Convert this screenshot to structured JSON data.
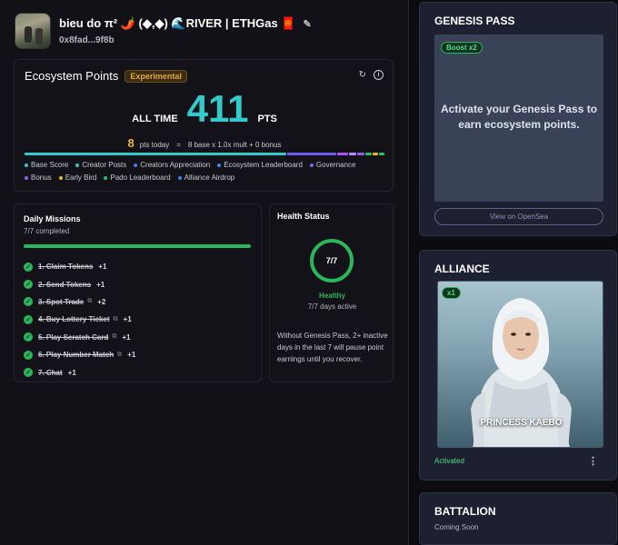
{
  "profile": {
    "name": "bieu do π² 🌶️ (◆,◆) 🌊RIVER | ETHGas 🧧",
    "address": "0x8fad...9f8b",
    "edit_icon": "pencil-icon"
  },
  "ecosystem": {
    "title": "Ecosystem Points",
    "badge": "Experimental",
    "all_time_label": "ALL TIME",
    "all_time_value": "411",
    "all_time_unit": "PTS",
    "today_value": "8",
    "today_label": "pts today",
    "today_equals": "=",
    "today_formula": "8 base x 1.0x mult + 0 bonus",
    "legend": [
      {
        "label": "Base Score",
        "color": "#35c9c9"
      },
      {
        "label": "Creator Posts",
        "color": "#35c9c9"
      },
      {
        "label": "Creators Appreciation",
        "color": "#3b82f6"
      },
      {
        "label": "Ecosystem Leaderboard",
        "color": "#3b82f6"
      },
      {
        "label": "Governance",
        "color": "#8b5cf6"
      },
      {
        "label": "Bonus",
        "color": "#a855f7"
      },
      {
        "label": "Early Bird",
        "color": "#f0b429"
      },
      {
        "label": "Pado Leaderboard",
        "color": "#22c55e"
      },
      {
        "label": "Alliance Airdrop",
        "color": "#3b82f6"
      }
    ],
    "bar_segments": [
      {
        "share": 0.74,
        "color": "#35c9c9"
      },
      {
        "share": 0.14,
        "color": "#6d5cf6"
      },
      {
        "share": 0.03,
        "color": "#a855f7"
      },
      {
        "share": 0.02,
        "color": "#c084fc"
      },
      {
        "share": 0.02,
        "color": "#8b5cf6"
      },
      {
        "share": 0.02,
        "color": "#22c55e"
      },
      {
        "share": 0.015,
        "color": "#f0b429"
      },
      {
        "share": 0.015,
        "color": "#22c55e"
      }
    ]
  },
  "missions": {
    "title": "Daily Missions",
    "completed": "7/7 completed",
    "progress": 1.0,
    "items": [
      {
        "label": "1. Claim Tokens",
        "points": "+1",
        "external": false
      },
      {
        "label": "2. Send Tokens",
        "points": "+1",
        "external": false
      },
      {
        "label": "3. Spot Trade",
        "points": "+2",
        "external": true
      },
      {
        "label": "4. Buy Lottery Ticket",
        "points": "+1",
        "external": true
      },
      {
        "label": "5. Play Scratch Card",
        "points": "+1",
        "external": true
      },
      {
        "label": "6. Play Number Match",
        "points": "+1",
        "external": true
      },
      {
        "label": "7. Chat",
        "points": "+1",
        "external": false
      }
    ]
  },
  "health": {
    "title": "Health Status",
    "ring_value": "7/7",
    "status": "Healthy",
    "days_active": "7/7 days active",
    "note": "Without Genesis Pass, 2+ inactive days in the last 7 will pause point earnings until you recover."
  },
  "genesis": {
    "title": "GENESIS PASS",
    "boost": "Boost x2",
    "message": "Activate your Genesis Pass to earn ecosystem points.",
    "button": "View on OpenSea"
  },
  "alliance": {
    "title": "ALLIANCE",
    "multiplier": "x1",
    "character_name": "PRINCESS KAEBO",
    "status": "Activated",
    "menu_icon": "kebab-menu-icon"
  },
  "battalion": {
    "title": "BATTALION",
    "subtitle": "Coming Soon"
  }
}
